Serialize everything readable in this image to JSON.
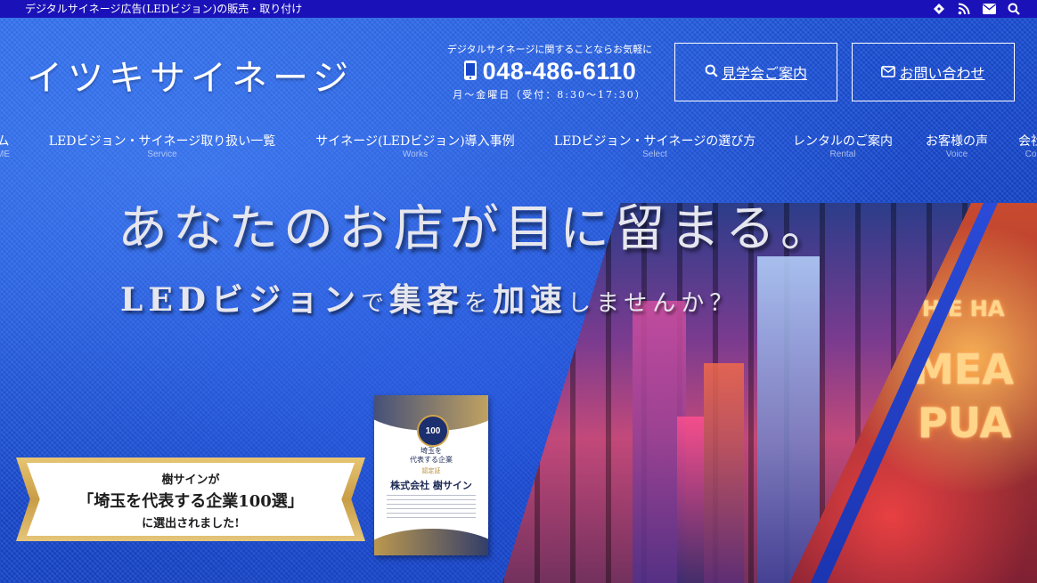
{
  "topbar": {
    "tagline": "デジタルサイネージ広告(LEDビジョン)の販売・取り付け",
    "icons": [
      "feedly-icon",
      "rss-icon",
      "mail-icon",
      "search-icon"
    ]
  },
  "header": {
    "logo": "イツキサイネージ",
    "contact_lead": "デジタルサイネージに関することならお気軽に",
    "phone": "048-486-6110",
    "hours": "月〜金曜日（受付：8:30〜17:30）",
    "tour_button": "見学会ご案内",
    "contact_button": "お問い合わせ"
  },
  "nav": {
    "items": [
      {
        "jp": "ム",
        "en": "ME"
      },
      {
        "jp": "LEDビジョン・サイネージ取り扱い一覧",
        "en": "Service"
      },
      {
        "jp": "サイネージ(LEDビジョン)導入事例",
        "en": "Works"
      },
      {
        "jp": "LEDビジョン・サイネージの選び方",
        "en": "Select"
      },
      {
        "jp": "レンタルのご案内",
        "en": "Rental"
      },
      {
        "jp": "お客様の声",
        "en": "Voice"
      },
      {
        "jp": "会社",
        "en": "Co"
      }
    ]
  },
  "hero": {
    "title": "あなたのお店が目に留まる。",
    "sub_parts": [
      {
        "text": "LEDビジョン",
        "size": "big"
      },
      {
        "text": "で",
        "size": "small"
      },
      {
        "text": "集客",
        "size": "big"
      },
      {
        "text": "を",
        "size": "small"
      },
      {
        "text": "加速",
        "size": "big"
      },
      {
        "text": "しませんか？",
        "size": "small"
      }
    ],
    "neon": {
      "line1": "HIE HA",
      "line2": "MEA",
      "line3": "PUA"
    }
  },
  "ribbon": {
    "line1": "樹サインが",
    "line2": "「埼玉を代表する企業100選」",
    "line3": "に選出されました!"
  },
  "certificate": {
    "badge": "100",
    "line1": "埼玉を",
    "line2": "代表する企業",
    "category": "認定証",
    "company": "株式会社 樹サイン"
  },
  "colors": {
    "topbar": "#1a12b8",
    "hero_blue": "#1747c9",
    "ribbon_gold": "#c99d45"
  }
}
